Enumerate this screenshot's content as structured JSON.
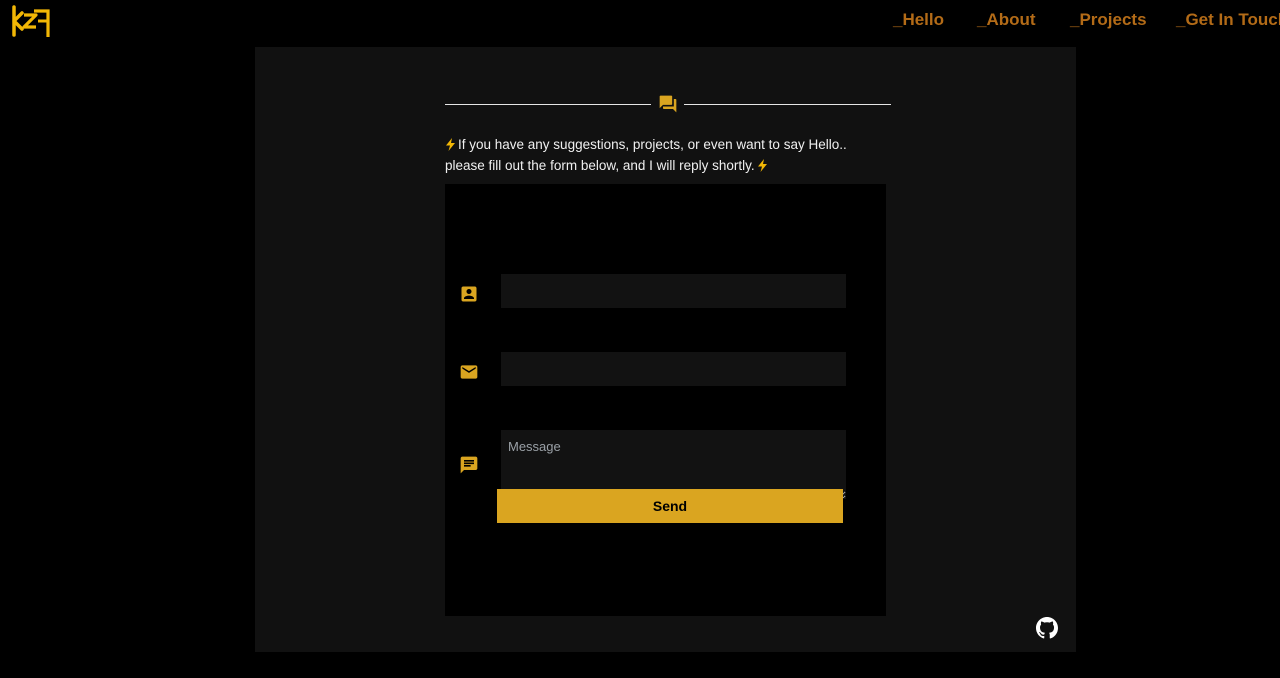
{
  "header": {
    "logo_icon": "kzy-logo-icon",
    "nav": [
      {
        "label": "_Hello"
      },
      {
        "label": "_About"
      },
      {
        "label": "_Projects"
      },
      {
        "label": "_Get In Touch"
      }
    ],
    "nav_color": "#b36b17"
  },
  "contact": {
    "divider_icon": "chat-bubbles-icon",
    "intro_line1": "If you have any suggestions, projects, or even want to say Hello..",
    "intro_line2": "please fill out the form below, and I will reply shortly.",
    "bolt_icon": "lightning-bolt-icon",
    "form": {
      "name_icon": "contact-card-icon",
      "name_value": "",
      "email_icon": "mail-icon",
      "email_value": "",
      "message_icon": "message-icon",
      "message_placeholder": "Message",
      "send_label": "Send"
    }
  },
  "footer": {
    "github_icon": "github-icon"
  },
  "colors": {
    "accent": "#daa520",
    "panel": "#111111",
    "background": "#000000"
  }
}
